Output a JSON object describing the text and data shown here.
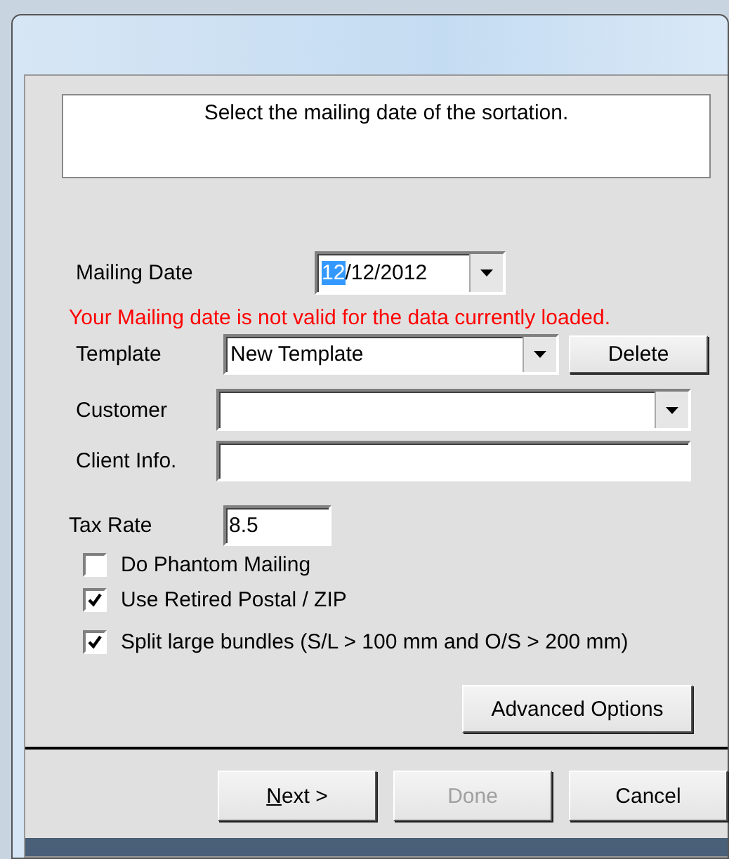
{
  "instruction": "Select the mailing date of the sortation.",
  "mailing_date": {
    "label": "Mailing Date",
    "segments": [
      {
        "text": "12",
        "selected": true
      },
      {
        "text": "/12/2012",
        "selected": false
      }
    ]
  },
  "error": "Your Mailing date is not valid for the data currently loaded.",
  "template": {
    "label": "Template",
    "value": "New Template",
    "delete_button": "Delete"
  },
  "customer": {
    "label": "Customer"
  },
  "client_info": {
    "label": "Client Info."
  },
  "tax_rate": {
    "label": "Tax Rate",
    "value": "8.5"
  },
  "checkboxes": [
    {
      "label": "Do Phantom Mailing",
      "checked": false
    },
    {
      "label": "Use Retired Postal / ZIP",
      "checked": true
    },
    {
      "label": "Split large bundles (S/L > 100 mm and O/S > 200 mm)",
      "checked": true
    }
  ],
  "advanced_button": "Advanced Options",
  "buttons": [
    {
      "label": "Next >",
      "underline_first": true,
      "disabled": false
    },
    {
      "label": "Done",
      "underline_first": false,
      "disabled": true
    },
    {
      "label": "Cancel",
      "underline_first": false,
      "disabled": false
    }
  ]
}
